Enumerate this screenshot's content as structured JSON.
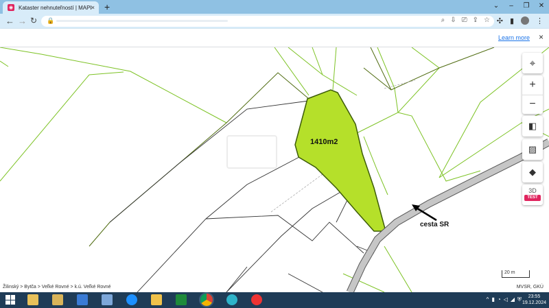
{
  "browser": {
    "tab_title": "Kataster nehnuteľností | MAPKA",
    "tab_close": "×",
    "new_tab": "+",
    "infobar_link": "Learn more",
    "infobar_close": "×",
    "win_controls": [
      "⌄",
      "–",
      "❐",
      "✕"
    ]
  },
  "map": {
    "parcel_area_label": "1410m2",
    "road_label": "cesta SR",
    "scale_label": "20 m",
    "breadcrumb": "Žilinský > Bytča > Veľké Rovné > k.ú. Veľké Rovné",
    "attribution": "MVSR, GKÚ",
    "highlight_color": "#b5e02a",
    "road_color": "#c6c6c6",
    "controls": {
      "locate": "⌖",
      "zoom_in": "+",
      "zoom_out": "−",
      "threed_label": "3D",
      "threed_badge": "TEST"
    }
  },
  "taskbar": {
    "time": "23:55",
    "date": "19.12.2024"
  }
}
